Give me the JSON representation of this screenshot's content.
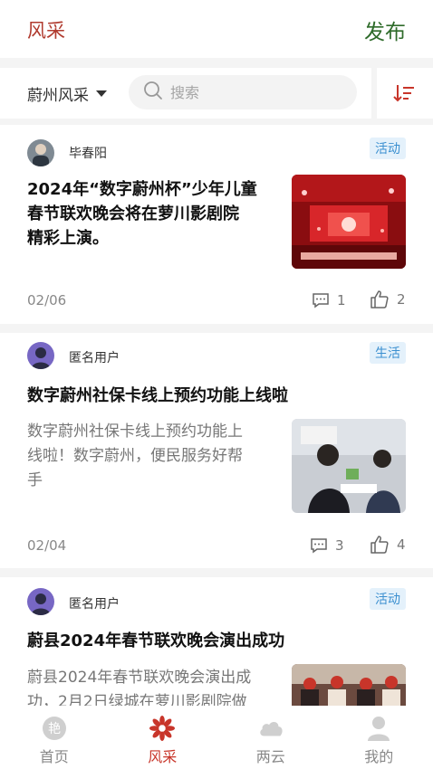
{
  "header": {
    "title": "风采",
    "publish_label": "发布"
  },
  "filter": {
    "area": "蔚州风采",
    "search_placeholder": "搜索"
  },
  "posts": [
    {
      "author": "毕春阳",
      "tag": "活动",
      "headline_lines": [
        "2024年“数字蔚州杯”少年儿童",
        "春节联欢晚会将在萝川影剧院",
        "精彩上演。"
      ],
      "summary_lines": [],
      "date": "02/06",
      "comments": "1",
      "likes": "2"
    },
    {
      "author": "匿名用户",
      "tag": "生活",
      "headline_lines": [
        "数字蔚州社保卡线上预约功能上线啦"
      ],
      "summary_lines": [
        "数字蔚州社保卡线上预约功能上",
        "线啦！数字蔚州，便民服务好帮",
        "手"
      ],
      "date": "02/04",
      "comments": "3",
      "likes": "4"
    },
    {
      "author": "匿名用户",
      "tag": "活动",
      "headline_lines": [
        "蔚县2024年春节联欢晚会演出成功"
      ],
      "summary_lines": [
        "蔚县2024年春节联欢晚会演出成",
        "功，2月2日绿城在萝川影剧院做"
      ],
      "date": "",
      "comments": "",
      "likes": ""
    }
  ],
  "tabs": [
    {
      "label": "首页",
      "icon": "home-logo-icon"
    },
    {
      "label": "风采",
      "icon": "flower-icon"
    },
    {
      "label": "两云",
      "icon": "cloud-icon"
    },
    {
      "label": "我的",
      "icon": "user-icon"
    }
  ],
  "colors": {
    "brand_red": "#c8352a",
    "publish_green": "#2e6b2a",
    "tag_blue": "#3a8fd0"
  }
}
